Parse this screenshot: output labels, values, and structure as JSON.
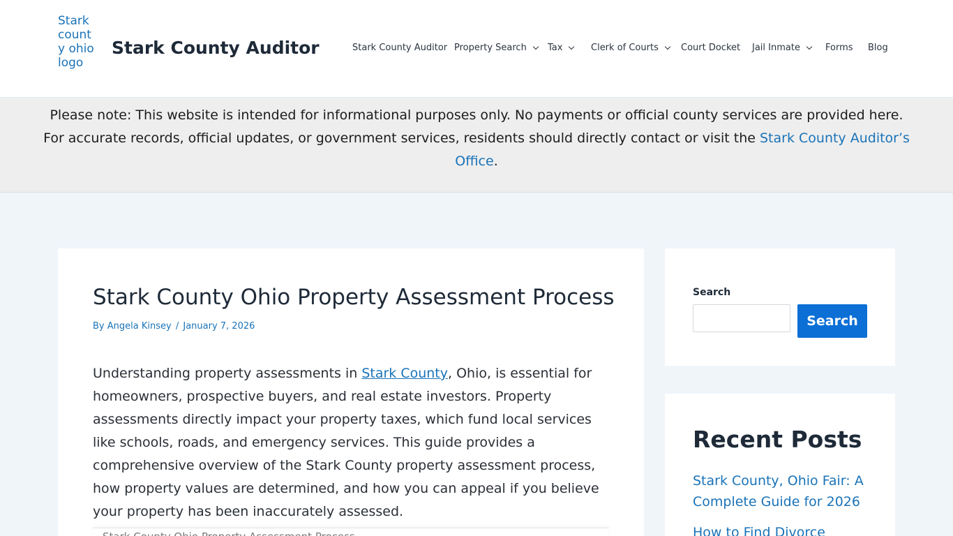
{
  "header": {
    "logo_alt": "Stark county ohio logo",
    "site_title": "Stark County Auditor",
    "nav": [
      {
        "label": "Stark County Auditor",
        "has_dropdown": false
      },
      {
        "label": "Property Search",
        "has_dropdown": true
      },
      {
        "label": "Tax",
        "has_dropdown": true
      },
      {
        "label": "Clerk of Courts",
        "has_dropdown": true
      },
      {
        "label": "Court Docket",
        "has_dropdown": false
      },
      {
        "label": "Jail Inmate",
        "has_dropdown": true
      },
      {
        "label": "Forms",
        "has_dropdown": false
      },
      {
        "label": "Blog",
        "has_dropdown": false
      }
    ]
  },
  "notice": {
    "line1": "Please note: This website is intended for informational purposes only. No payments or official county services are provided here.",
    "line2_text": "For accurate records, official updates, or government services, residents should directly contact or visit the ",
    "link_part1": "Stark County Auditor’s",
    "link_part2": "Office",
    "line3_suffix": "."
  },
  "article": {
    "title": "Stark County Ohio Property Assessment Process",
    "meta_prefix": "By ",
    "author": "Angela Kinsey",
    "meta_sep": "/",
    "date": "January 7, 2026",
    "intro_before_link": "Understanding property assessments in ",
    "intro_link": "Stark County",
    "intro_after_link": ", Ohio, is essential for homeowners, prospective buyers, and real estate investors. Property assessments directly impact your property taxes, which fund local services like schools, roads, and emergency services. This guide provides a comprehensive overview of the Stark County property assessment process, how property values are determined, and how you can appeal if you believe your property has been inaccurately assessed.",
    "image_alt": "Stark County Ohio Property Assessment Process"
  },
  "sidebar": {
    "search": {
      "label": "Search",
      "input_value": "",
      "button_label": "Search"
    },
    "recent": {
      "title": "Recent Posts",
      "items": [
        "Stark County, Ohio Fair: A Complete Guide for 2026",
        "How to Find Divorce"
      ]
    }
  },
  "colors": {
    "link": "#1a73b8",
    "button": "#0b6fd6",
    "background": "#f0f5fa",
    "notice_bg": "#eeeeee"
  }
}
